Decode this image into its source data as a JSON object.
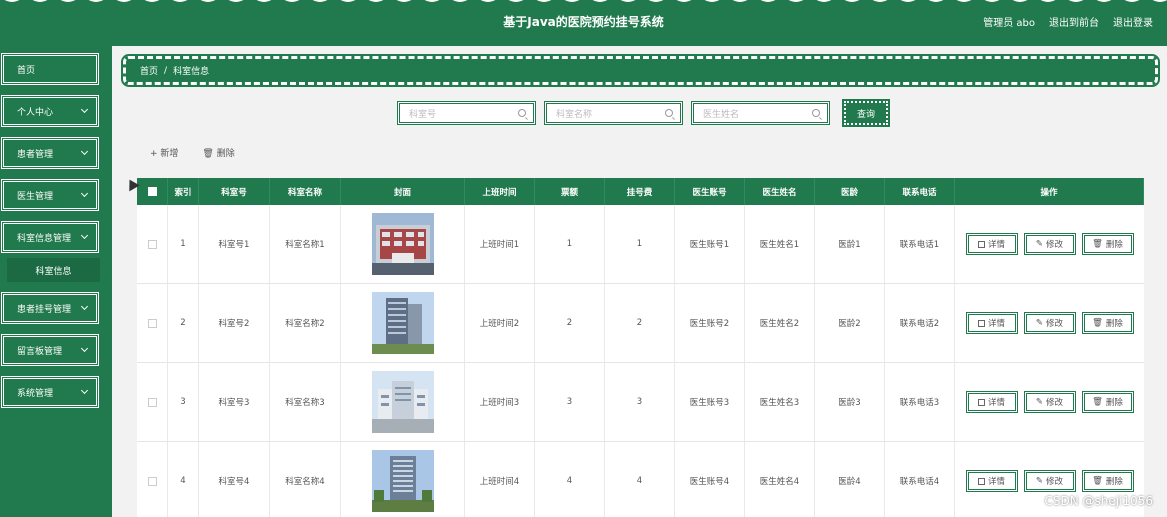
{
  "header": {
    "title": "基于Java的医院预约挂号系统",
    "user": "管理员 abo",
    "front": "退出到前台",
    "logout": "退出登录"
  },
  "sidebar": {
    "items": [
      {
        "label": "首页",
        "chevron": false
      },
      {
        "label": "个人中心",
        "chevron": true
      },
      {
        "label": "患者管理",
        "chevron": true
      },
      {
        "label": "医生管理",
        "chevron": true
      },
      {
        "label": "科室信息管理",
        "chevron": true
      },
      {
        "label": "患者挂号管理",
        "chevron": true
      },
      {
        "label": "留言板管理",
        "chevron": true
      },
      {
        "label": "系统管理",
        "chevron": true
      }
    ],
    "sub_item": "科室信息"
  },
  "breadcrumb": {
    "home": "首页",
    "sep": "/",
    "current": "科室信息"
  },
  "search": {
    "p1": "科室号",
    "p2": "科室名称",
    "p3": "医生姓名",
    "button": "查询"
  },
  "actions": {
    "add": "+ 新增",
    "delete": "删除"
  },
  "table": {
    "headers": [
      "索引",
      "科室号",
      "科室名称",
      "封面",
      "上班时间",
      "票额",
      "挂号费",
      "医生账号",
      "医生姓名",
      "医龄",
      "联系电话",
      "操作"
    ],
    "rows": [
      {
        "idx": "1",
        "num": "科室号1",
        "name": "科室名称1",
        "time": "上班时间1",
        "price": "1",
        "fee": "1",
        "acc": "医生账号1",
        "doc": "医生姓名1",
        "age": "医龄1",
        "tel": "联系电话1"
      },
      {
        "idx": "2",
        "num": "科室号2",
        "name": "科室名称2",
        "time": "上班时间2",
        "price": "2",
        "fee": "2",
        "acc": "医生账号2",
        "doc": "医生姓名2",
        "age": "医龄2",
        "tel": "联系电话2"
      },
      {
        "idx": "3",
        "num": "科室号3",
        "name": "科室名称3",
        "time": "上班时间3",
        "price": "3",
        "fee": "3",
        "acc": "医生账号3",
        "doc": "医生姓名3",
        "age": "医龄3",
        "tel": "联系电话3"
      },
      {
        "idx": "4",
        "num": "科室号4",
        "name": "科室名称4",
        "time": "上班时间4",
        "price": "4",
        "fee": "4",
        "acc": "医生账号4",
        "doc": "医生姓名4",
        "age": "医龄4",
        "tel": "联系电话4"
      }
    ],
    "btn_detail": "详情",
    "btn_edit": "修改",
    "btn_delete": "删除"
  },
  "watermark": "CSDN @sheji1056",
  "colors": {
    "primary": "#217a4e"
  }
}
